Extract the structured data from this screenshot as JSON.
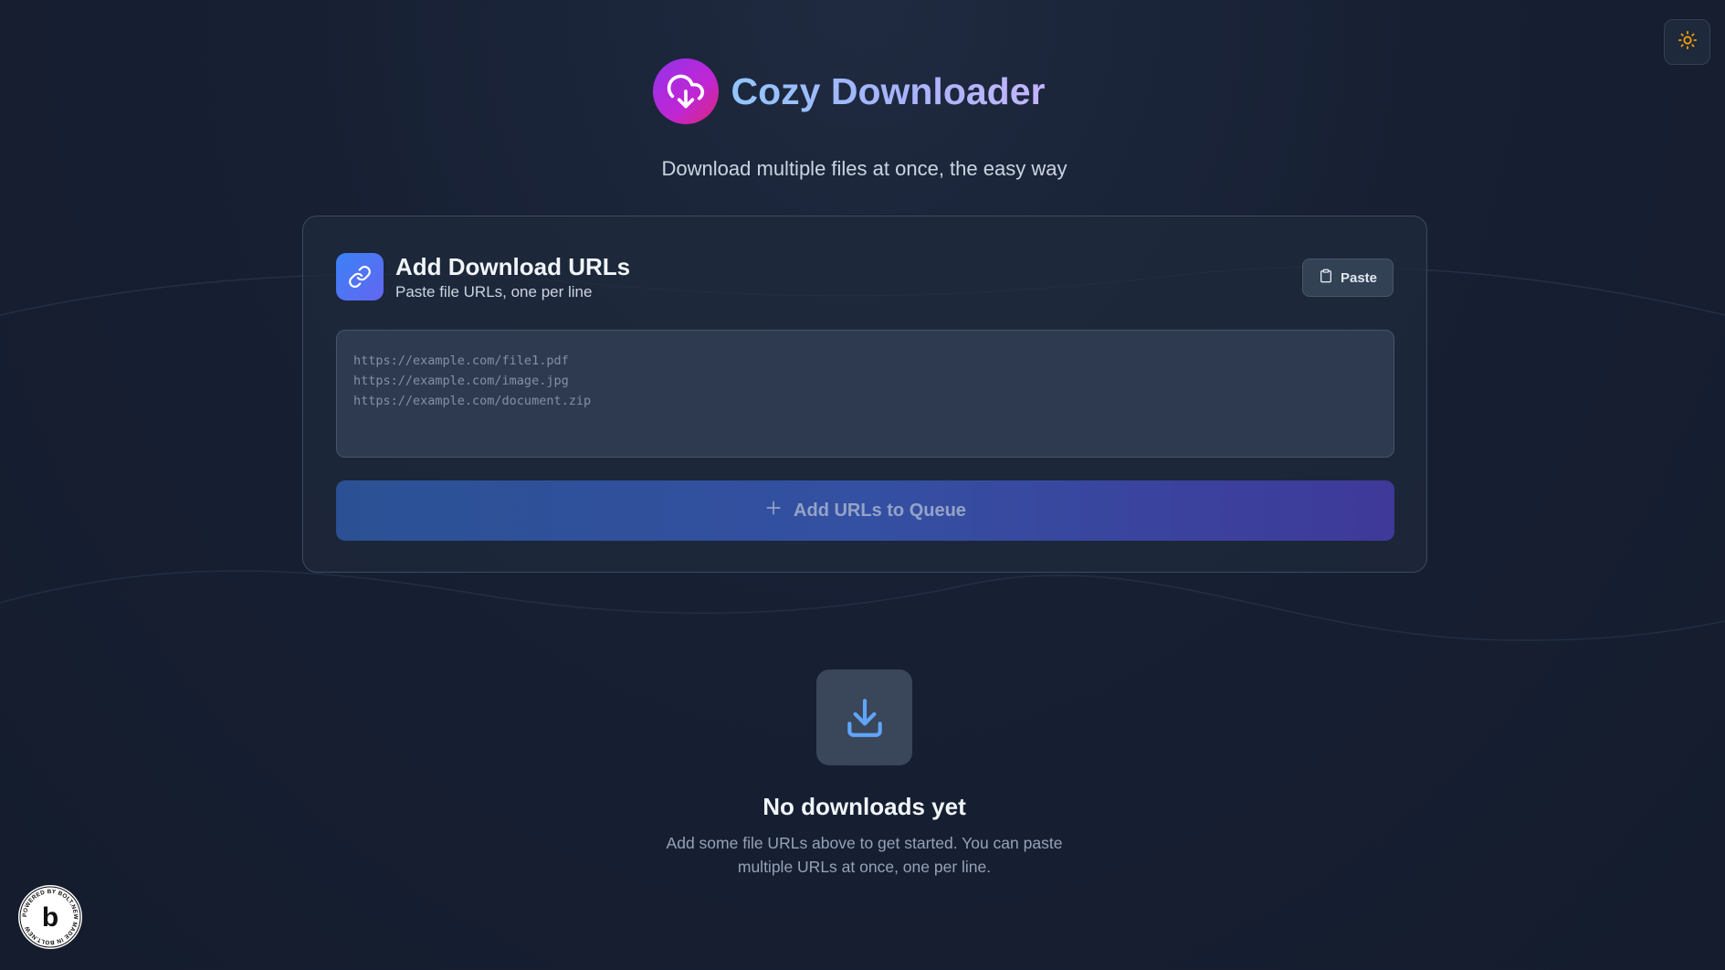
{
  "header": {
    "app_title": "Cozy Downloader",
    "subtitle": "Download multiple files at once, the easy way",
    "logo_icon": "cloud-download-icon"
  },
  "theme_toggle": {
    "icon": "sun-icon"
  },
  "url_card": {
    "title": "Add Download URLs",
    "subtitle": "Paste file URLs, one per line",
    "icon": "link-icon",
    "paste_label": "Paste",
    "paste_icon": "clipboard-icon",
    "textarea_value": "",
    "textarea_placeholder": "https://example.com/file1.pdf\nhttps://example.com/image.jpg\nhttps://example.com/document.zip",
    "add_button_label": "Add URLs to Queue",
    "add_button_icon": "plus-icon"
  },
  "empty_state": {
    "icon": "download-icon",
    "title": "No downloads yet",
    "description": "Add some file URLs above to get started. You can paste multiple URLs at once, one per line."
  },
  "badge": {
    "icon": "bolt-badge-icon",
    "text": "POWERED BY BOLT.NEW MADE IN BOLT.NEW"
  },
  "colors": {
    "background": "#172033",
    "card": "#1e293b",
    "accent_blue": "#3b82f6",
    "accent_purple": "#9333ea",
    "sun": "#f59e0b"
  }
}
